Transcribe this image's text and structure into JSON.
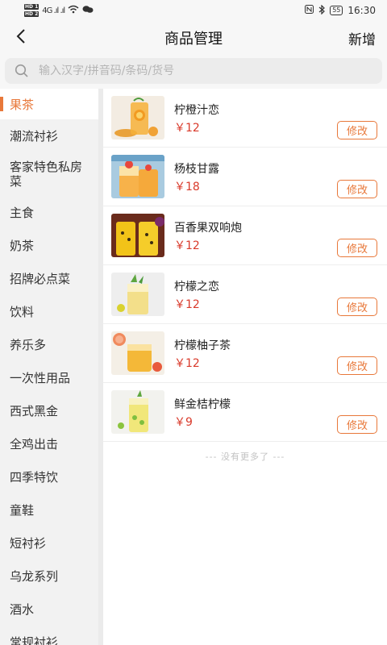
{
  "status_bar": {
    "sim1": "HD 1",
    "sim2": "HD 2",
    "signal": "4G .ıl .ıl",
    "battery": "55",
    "time": "16:30"
  },
  "header": {
    "title": "商品管理",
    "add_label": "新增"
  },
  "search": {
    "placeholder": "输入汉字/拼音码/条码/货号"
  },
  "accent_color": "#e8783a",
  "price_color": "#d93a2b",
  "sidebar": {
    "items": [
      {
        "label": "果茶",
        "active": true
      },
      {
        "label": "潮流衬衫"
      },
      {
        "label": "客家特色私房菜"
      },
      {
        "label": "主食"
      },
      {
        "label": "奶茶"
      },
      {
        "label": "招牌必点菜"
      },
      {
        "label": "饮料"
      },
      {
        "label": "养乐多"
      },
      {
        "label": "一次性用品"
      },
      {
        "label": "西式黑金"
      },
      {
        "label": "全鸡出击"
      },
      {
        "label": "四季特饮"
      },
      {
        "label": "童鞋"
      },
      {
        "label": "短衬衫"
      },
      {
        "label": "乌龙系列"
      },
      {
        "label": "酒水"
      },
      {
        "label": "常规衬衫"
      }
    ]
  },
  "products": [
    {
      "name": "柠橙汁恋",
      "price": "￥12",
      "edit_label": "修改"
    },
    {
      "name": "杨枝甘露",
      "price": "￥18",
      "edit_label": "修改"
    },
    {
      "name": "百香果双响炮",
      "price": "￥12",
      "edit_label": "修改"
    },
    {
      "name": "柠檬之恋",
      "price": "￥12",
      "edit_label": "修改"
    },
    {
      "name": "柠檬柚子茶",
      "price": "￥12",
      "edit_label": "修改"
    },
    {
      "name": "鲜金桔柠檬",
      "price": "￥9",
      "edit_label": "修改"
    }
  ],
  "list_footer": "--- 没有更多了 ---"
}
